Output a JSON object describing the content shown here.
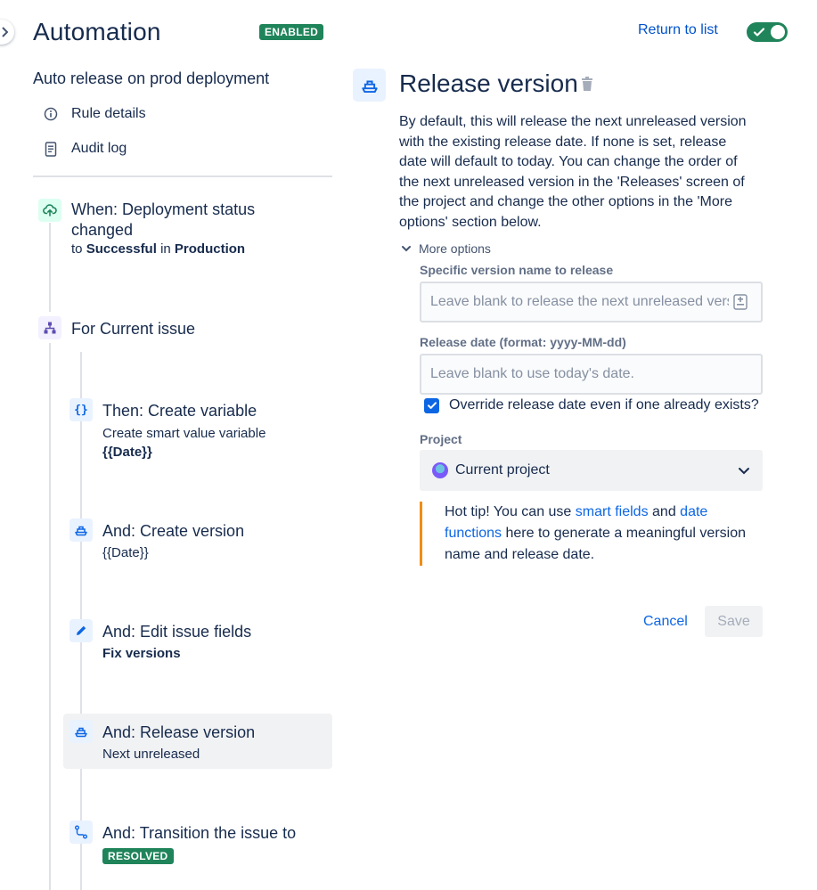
{
  "header": {
    "title": "Automation",
    "status_badge": "ENABLED",
    "return_link": "Return to list",
    "toggle_on": true
  },
  "sidebar": {
    "rule_name": "Auto release on prod deployment",
    "links": [
      {
        "label": "Rule details",
        "icon": "info-icon"
      },
      {
        "label": "Audit log",
        "icon": "document-icon"
      }
    ]
  },
  "rule": {
    "trigger": {
      "title": "When: Deployment status changed",
      "sub_prefix": "to ",
      "sub_status": "Successful",
      "sub_mid": " in ",
      "sub_env": "Production",
      "icon": "cloud-upload-icon"
    },
    "branch": {
      "title": "For Current issue",
      "icon": "hierarchy-icon"
    },
    "steps": [
      {
        "title": "Then: Create variable",
        "line1": "Create smart value variable",
        "line2": "{{Date}}",
        "icon": "braces-icon"
      },
      {
        "title": "And: Create version",
        "line1": "{{Date}}",
        "icon": "ship-icon"
      },
      {
        "title": "And: Edit issue fields",
        "line1": "Fix versions",
        "icon": "pencil-icon"
      },
      {
        "title": "And: Release version",
        "line1": "Next unreleased",
        "icon": "ship-icon",
        "selected": true
      },
      {
        "title": "And: Transition the issue to",
        "badge": "RESOLVED",
        "icon": "transition-icon"
      }
    ]
  },
  "panel": {
    "title": "Release version",
    "description": "By default, this will release the next unreleased version with the existing release date. If none is set, release date will default to today. You can change the order of the next unreleased version in the 'Releases' screen of the project and change the other options in the 'More options' section below.",
    "more_options": "More options",
    "version_label": "Specific version name to release",
    "version_placeholder": "Leave blank to release the next unreleased version",
    "date_label": "Release date (format: yyyy-MM-dd)",
    "date_placeholder": "Leave blank to use today's date.",
    "override_label": "Override release date even if one already exists?",
    "override_checked": true,
    "project_label": "Project",
    "project_value": "Current project",
    "tip": {
      "prefix": "Hot tip! You can use ",
      "link1": "smart fields",
      "mid": " and ",
      "link2": "date functions",
      "suffix": " here to generate a meaningful version name and release date."
    },
    "cancel": "Cancel",
    "save": "Save"
  },
  "colors": {
    "accent": "#0c66e4",
    "success": "#1f845a",
    "tip_border": "#f18d13"
  }
}
